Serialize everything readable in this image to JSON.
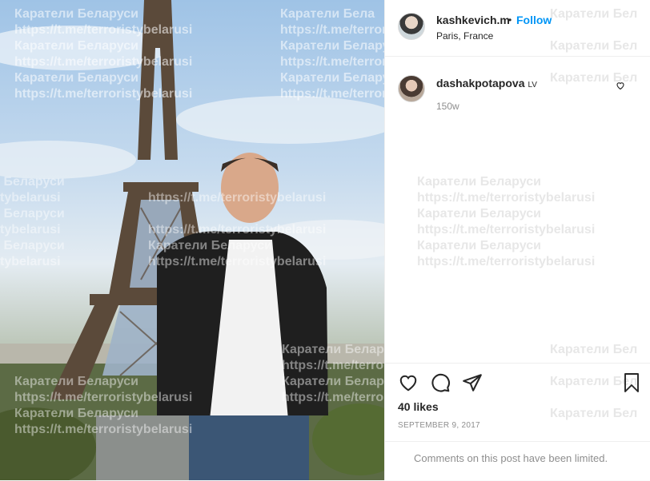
{
  "post": {
    "username": "kashkevich.m",
    "location": "Paris, France",
    "follow_label": "Follow",
    "dot": "•"
  },
  "comment": {
    "username": "dashakpotapova",
    "badge": "LV",
    "time": "150w"
  },
  "likes": "40 likes",
  "date": "SEPTEMBER 9, 2017",
  "comments_limited": "Comments on this post have been limited.",
  "watermark": {
    "line1": "Каратели Беларуси",
    "line2": "https://t.me/terroristybelarusi",
    "frag_a": "ли Беларуси",
    "frag_b": "tybelarusi",
    "frag_c": "Каратели Бела",
    "frag_d": "Каратели Бел"
  },
  "icons": [
    "heart-icon",
    "comment-icon",
    "share-icon",
    "bookmark-icon",
    "like-comment-icon"
  ],
  "colors": {
    "accent": "#0095f6",
    "text": "#262626",
    "muted": "#8e8e8e"
  }
}
